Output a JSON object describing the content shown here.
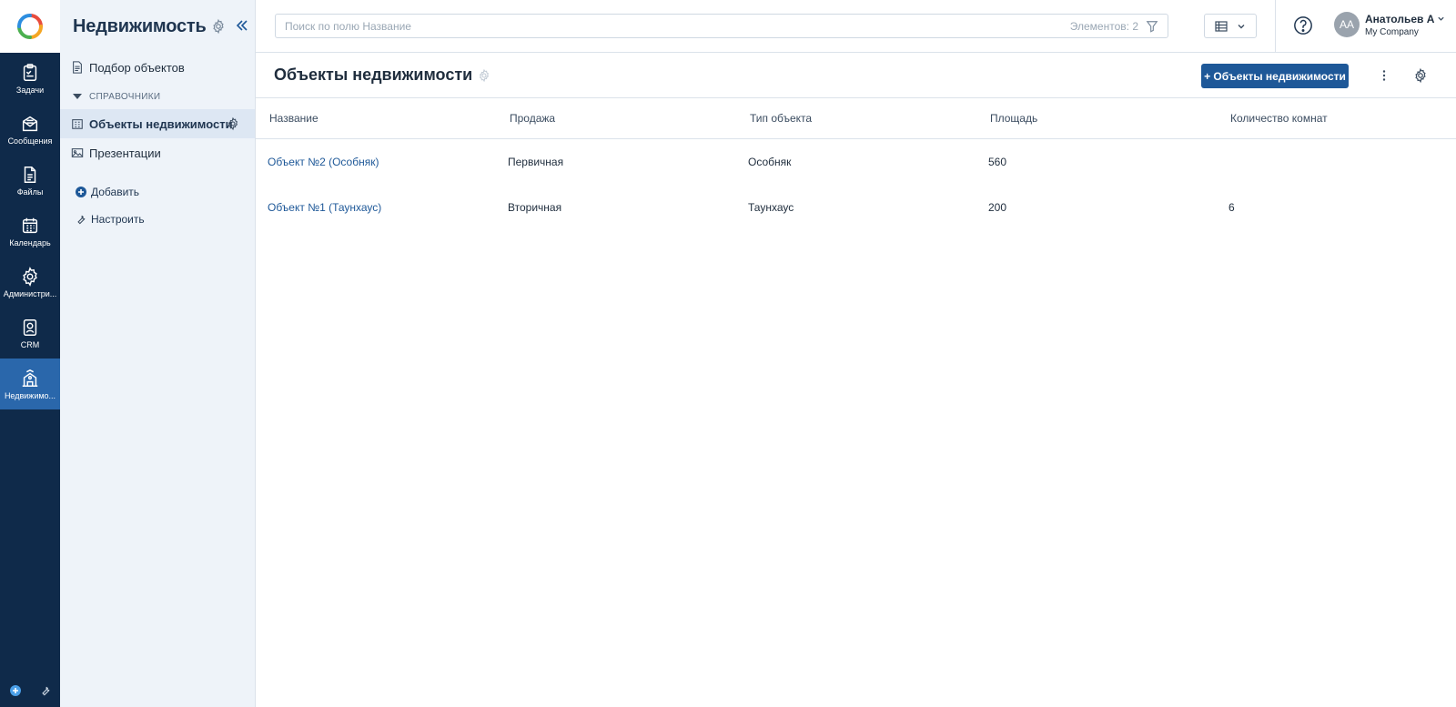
{
  "rail": {
    "items": [
      {
        "label": "Задачи",
        "icon": "tasks-icon"
      },
      {
        "label": "Сообщения",
        "icon": "messages-icon"
      },
      {
        "label": "Файлы",
        "icon": "files-icon"
      },
      {
        "label": "Календарь",
        "icon": "calendar-icon"
      },
      {
        "label": "Администри...",
        "icon": "gear-icon"
      },
      {
        "label": "CRM",
        "icon": "crm-icon"
      },
      {
        "label": "Недвижимо...",
        "icon": "real-estate-icon"
      }
    ],
    "active_index": 6
  },
  "sidebar": {
    "title": "Недвижимость",
    "top_link": "Подбор объектов",
    "section_label": "СПРАВОЧНИКИ",
    "items": [
      {
        "label": "Объекты недвижимости"
      },
      {
        "label": "Презентации"
      }
    ],
    "add_label": "Добавить",
    "configure_label": "Настроить"
  },
  "topbar": {
    "search_placeholder": "Поиск по полю Название",
    "count_label": "Элементов: 2",
    "user_initials": "АА",
    "user_name": "Анатольев А",
    "user_company": "My Company"
  },
  "page": {
    "title": "Объекты недвижимости",
    "add_button": "+ Объекты недвижимости"
  },
  "table": {
    "columns": [
      "Название",
      "Продажа",
      "Тип объекта",
      "Площадь",
      "Количество комнат"
    ],
    "rows": [
      {
        "name": "Объект №2 (Особняк)",
        "sale": "Первичная",
        "type": "Особняк",
        "area": "560",
        "rooms": ""
      },
      {
        "name": "Объект №1 (Таунхаус)",
        "sale": "Вторичная",
        "type": "Таунхаус",
        "area": "200",
        "rooms": "6"
      }
    ]
  },
  "colors": {
    "rail_bg": "#0f2a4a",
    "rail_active": "#2a67ab",
    "sidebar_bg": "#eef3f9",
    "primary_button": "#1e5898",
    "link": "#1e5898"
  }
}
